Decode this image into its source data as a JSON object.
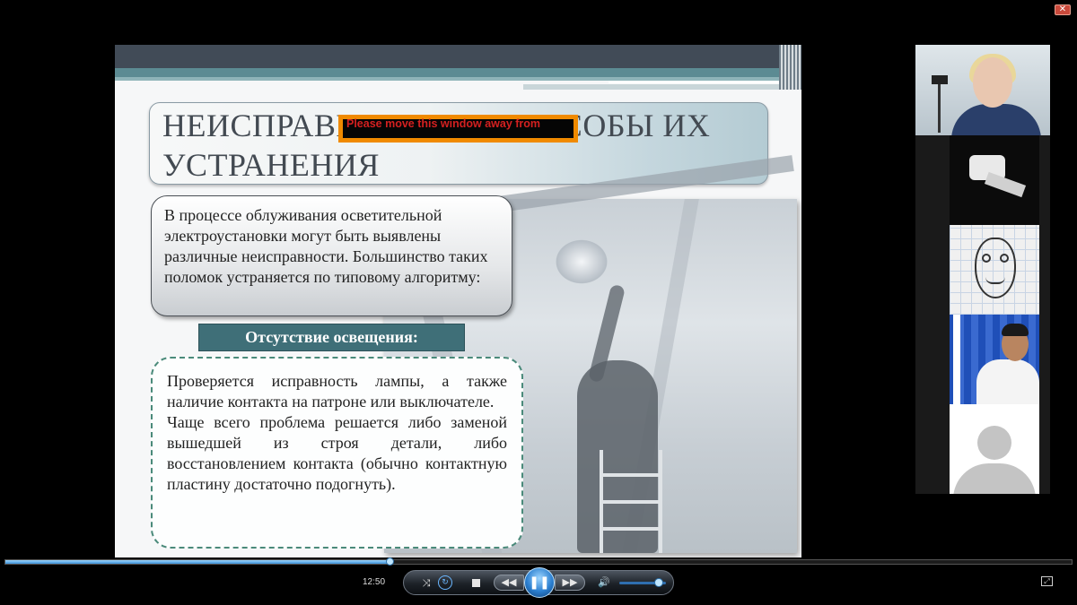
{
  "window": {
    "close_glyph": "✕"
  },
  "slide": {
    "title": "НЕИСПРАВНОСТИ И СПОСОБЫ ИХ УСТРАНЕНИЯ",
    "intro": "В процессе облуживания осветительной электроустановки могут быть выявлены различные неисправности. Большинство таких поломок устраняется по типовому алгоритму:",
    "subheader": "Отсутствие освещения:",
    "paragraph1": "Проверяется исправность лампы, а также наличие контакта на патроне или выключателе.",
    "paragraph2": "Чаще всего проблема решается либо заменой вышедшей из строя детали, либо восстановлением контакта (обычно контактную пластину достаточно подогнуть)."
  },
  "overlay_notice": "Please move this window away from",
  "participants": [
    {
      "id": "participant-1",
      "kind": "video"
    },
    {
      "id": "participant-2",
      "kind": "video"
    },
    {
      "id": "participant-3",
      "kind": "drawing"
    },
    {
      "id": "participant-4",
      "kind": "video"
    },
    {
      "id": "participant-5",
      "kind": "avatar-placeholder"
    }
  ],
  "player": {
    "time": "12:50",
    "progress_fraction": 0.36,
    "volume_fraction": 0.85,
    "icons": {
      "shuffle": "shuffle-icon",
      "repeat": "repeat-icon",
      "stop": "stop-icon",
      "prev": "rewind-icon",
      "play_pause": "pause-icon",
      "next": "fast-forward-icon",
      "volume": "volume-icon",
      "fullscreen": "switch-view-icon"
    },
    "glyphs": {
      "shuffle": "⤨",
      "repeat": "↻",
      "prev": "◀◀",
      "pause": "❚❚",
      "next": "▶▶",
      "volume": "🔊",
      "fullscreen": "⤢"
    }
  },
  "colors": {
    "accent": "#3f6f78",
    "title_text": "#434a52",
    "notice_border": "#f08a00",
    "notice_text": "#d42020",
    "player_accent": "#2b7fd0"
  }
}
